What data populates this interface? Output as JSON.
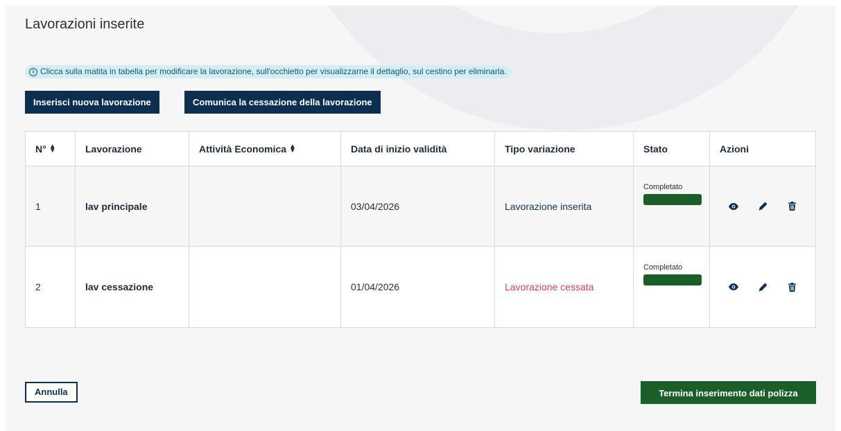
{
  "page": {
    "title": "Lavorazioni inserite",
    "info_icon": "info-circle-icon",
    "info_text": "Clicca sulla matita in tabella per modificare la lavorazione, sull'occhietto per visualizzarne il dettaglio, sul cestino per eliminarla."
  },
  "toolbar": {
    "insert_label": "Inserisci nuova lavorazione",
    "cessation_label": "Comunica la cessazione della lavorazione"
  },
  "table": {
    "headers": {
      "num": "N°",
      "lavorazione": "Lavorazione",
      "attivita": "Attività Economica",
      "data": "Data di inizio validità",
      "tipo": "Tipo variazione",
      "stato": "Stato",
      "azioni": "Azioni"
    },
    "sortable_icon": "sort-icon",
    "rows": [
      {
        "num": "1",
        "lavorazione": "lav principale",
        "attivita": "",
        "data": "03/04/2026",
        "tipo": "Lavorazione inserita",
        "tipo_color": "#17324d",
        "stato": "Completato",
        "stato_color": "#1b5e2a",
        "actions": [
          "eye-icon",
          "pencil-icon",
          "trash-icon"
        ]
      },
      {
        "num": "2",
        "lavorazione": "lav cessazione",
        "attivita": "",
        "data": "01/04/2026",
        "tipo": "Lavorazione cessata",
        "tipo_color": "#d64553",
        "stato": "Completato",
        "stato_color": "#1b5e2a",
        "actions": [
          "eye-icon",
          "pencil-icon",
          "trash-icon"
        ]
      }
    ]
  },
  "footer": {
    "cancel_label": "Annulla",
    "finish_label": "Termina inserimento dati polizza"
  },
  "colors": {
    "primary": "#0c2e50",
    "success": "#1b5e2a",
    "danger": "#d64553",
    "info_bg": "#d2eef4"
  }
}
